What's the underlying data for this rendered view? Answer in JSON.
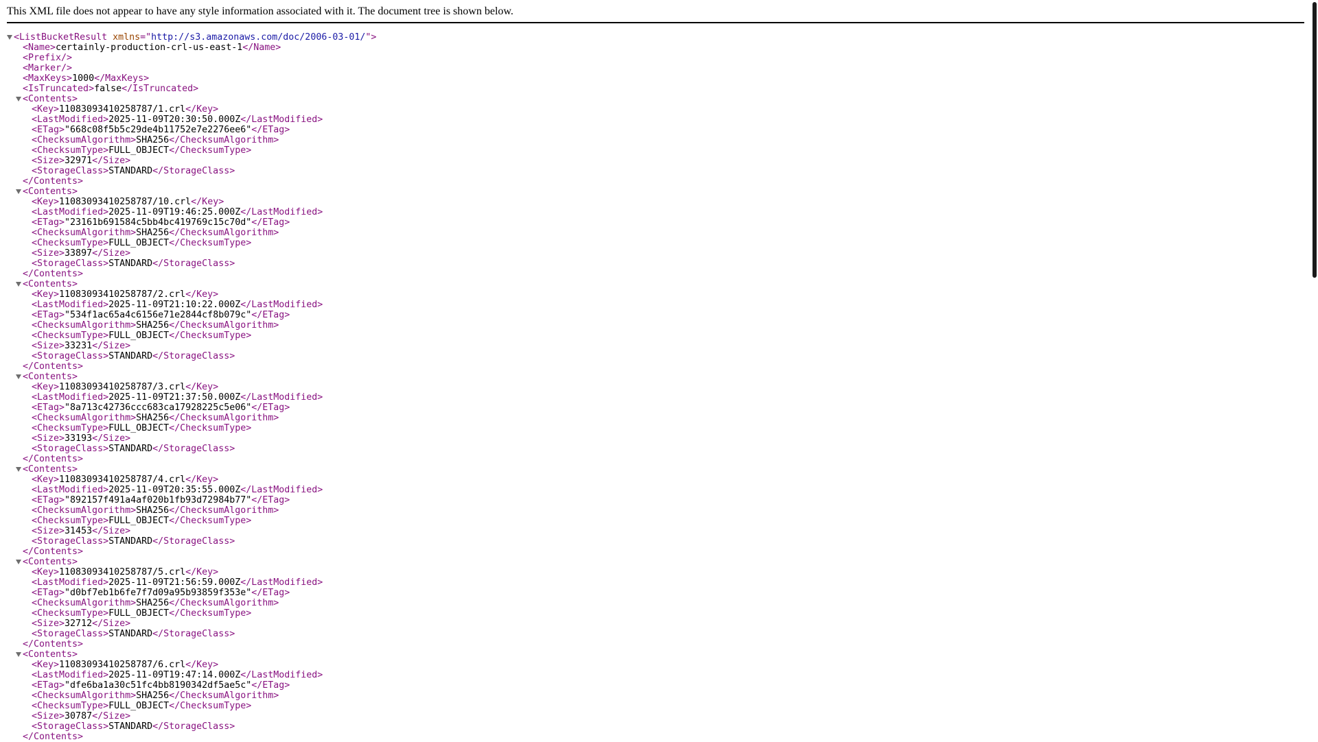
{
  "header": {
    "notice": "This XML file does not appear to have any style information associated with it. The document tree is shown below."
  },
  "colors": {
    "tag": "#881280",
    "attr_name": "#994500",
    "attr_value": "#1a1aa6"
  },
  "root": {
    "tag": "ListBucketResult",
    "attr_name": "xmlns",
    "attr_value": "http://s3.amazonaws.com/doc/2006-03-01/",
    "fields": [
      {
        "tag": "Name",
        "value": "certainly-production-crl-us-east-1"
      },
      {
        "tag": "Prefix",
        "value": null
      },
      {
        "tag": "Marker",
        "value": null
      },
      {
        "tag": "MaxKeys",
        "value": "1000"
      },
      {
        "tag": "IsTruncated",
        "value": "false"
      }
    ],
    "contents_tag": "Contents",
    "contents": [
      {
        "Key": "11083093410258787/1.crl",
        "LastModified": "2025-11-09T20:30:50.000Z",
        "ETag": "\"668c08f5b5c29de4b11752e7e2276ee6\"",
        "ChecksumAlgorithm": "SHA256",
        "ChecksumType": "FULL_OBJECT",
        "Size": "32971",
        "StorageClass": "STANDARD"
      },
      {
        "Key": "11083093410258787/10.crl",
        "LastModified": "2025-11-09T19:46:25.000Z",
        "ETag": "\"23161b691584c5bb4bc419769c15c70d\"",
        "ChecksumAlgorithm": "SHA256",
        "ChecksumType": "FULL_OBJECT",
        "Size": "33897",
        "StorageClass": "STANDARD"
      },
      {
        "Key": "11083093410258787/2.crl",
        "LastModified": "2025-11-09T21:10:22.000Z",
        "ETag": "\"534f1ac65a4c6156e71e2844cf8b079c\"",
        "ChecksumAlgorithm": "SHA256",
        "ChecksumType": "FULL_OBJECT",
        "Size": "33231",
        "StorageClass": "STANDARD"
      },
      {
        "Key": "11083093410258787/3.crl",
        "LastModified": "2025-11-09T21:37:50.000Z",
        "ETag": "\"8a713c42736ccc683ca17928225c5e06\"",
        "ChecksumAlgorithm": "SHA256",
        "ChecksumType": "FULL_OBJECT",
        "Size": "33193",
        "StorageClass": "STANDARD"
      },
      {
        "Key": "11083093410258787/4.crl",
        "LastModified": "2025-11-09T20:35:55.000Z",
        "ETag": "\"892157f491a4af020b1fb93d72984b77\"",
        "ChecksumAlgorithm": "SHA256",
        "ChecksumType": "FULL_OBJECT",
        "Size": "31453",
        "StorageClass": "STANDARD"
      },
      {
        "Key": "11083093410258787/5.crl",
        "LastModified": "2025-11-09T21:56:59.000Z",
        "ETag": "\"d0bf7eb1b6fe7f7d09a95b93859f353e\"",
        "ChecksumAlgorithm": "SHA256",
        "ChecksumType": "FULL_OBJECT",
        "Size": "32712",
        "StorageClass": "STANDARD"
      },
      {
        "Key": "11083093410258787/6.crl",
        "LastModified": "2025-11-09T19:47:14.000Z",
        "ETag": "\"dfe6ba1a30c51fc4bb8190342df5ae5c\"",
        "ChecksumAlgorithm": "SHA256",
        "ChecksumType": "FULL_OBJECT",
        "Size": "30787",
        "StorageClass": "STANDARD"
      }
    ]
  }
}
